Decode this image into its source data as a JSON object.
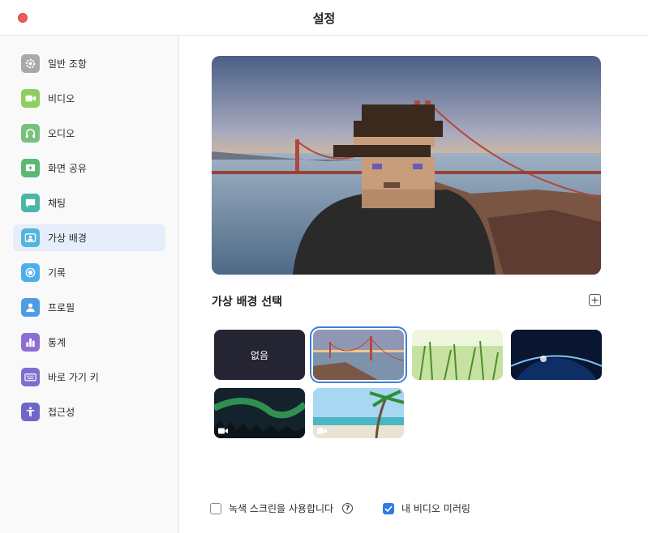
{
  "window": {
    "title": "설정"
  },
  "sidebar": {
    "items": [
      {
        "label": "일반 조항",
        "icon": "gear-icon",
        "color": "#a9a9a9"
      },
      {
        "label": "비디오",
        "icon": "video-camera-icon",
        "color": "#8ccf5e"
      },
      {
        "label": "오디오",
        "icon": "headphones-icon",
        "color": "#79c07c"
      },
      {
        "label": "화면 공유",
        "icon": "share-screen-icon",
        "color": "#5cb870"
      },
      {
        "label": "채팅",
        "icon": "chat-bubble-icon",
        "color": "#4cb6a6"
      },
      {
        "label": "가상 배경",
        "icon": "virtual-background-icon",
        "color": "#52b5dc",
        "active": true
      },
      {
        "label": "기록",
        "icon": "record-icon",
        "color": "#4eb0ea"
      },
      {
        "label": "프로필",
        "icon": "profile-icon",
        "color": "#4f9be6"
      },
      {
        "label": "통계",
        "icon": "statistics-icon",
        "color": "#8e6fd1"
      },
      {
        "label": "바로 가기 키",
        "icon": "keyboard-icon",
        "color": "#7f6dcf"
      },
      {
        "label": "접근성",
        "icon": "accessibility-icon",
        "color": "#6f66c9"
      }
    ]
  },
  "main": {
    "section_title": "가상 배경 선택",
    "add_button_label": "+",
    "none_label": "없음",
    "backgrounds": [
      {
        "name": "none"
      },
      {
        "name": "golden-gate-bridge",
        "selected": true
      },
      {
        "name": "grass"
      },
      {
        "name": "earth-from-space"
      },
      {
        "name": "aurora",
        "video": true
      },
      {
        "name": "beach-palm",
        "video": true
      }
    ],
    "green_screen_label": "녹색 스크린을 사용합니다",
    "help_label": "?",
    "mirror_label": "내 비디오 미러링",
    "green_screen_checked": false,
    "mirror_checked": true
  },
  "colors": {
    "accent": "#2f7be5",
    "close": "#ec5f58",
    "active_bg": "#e5eefa"
  }
}
